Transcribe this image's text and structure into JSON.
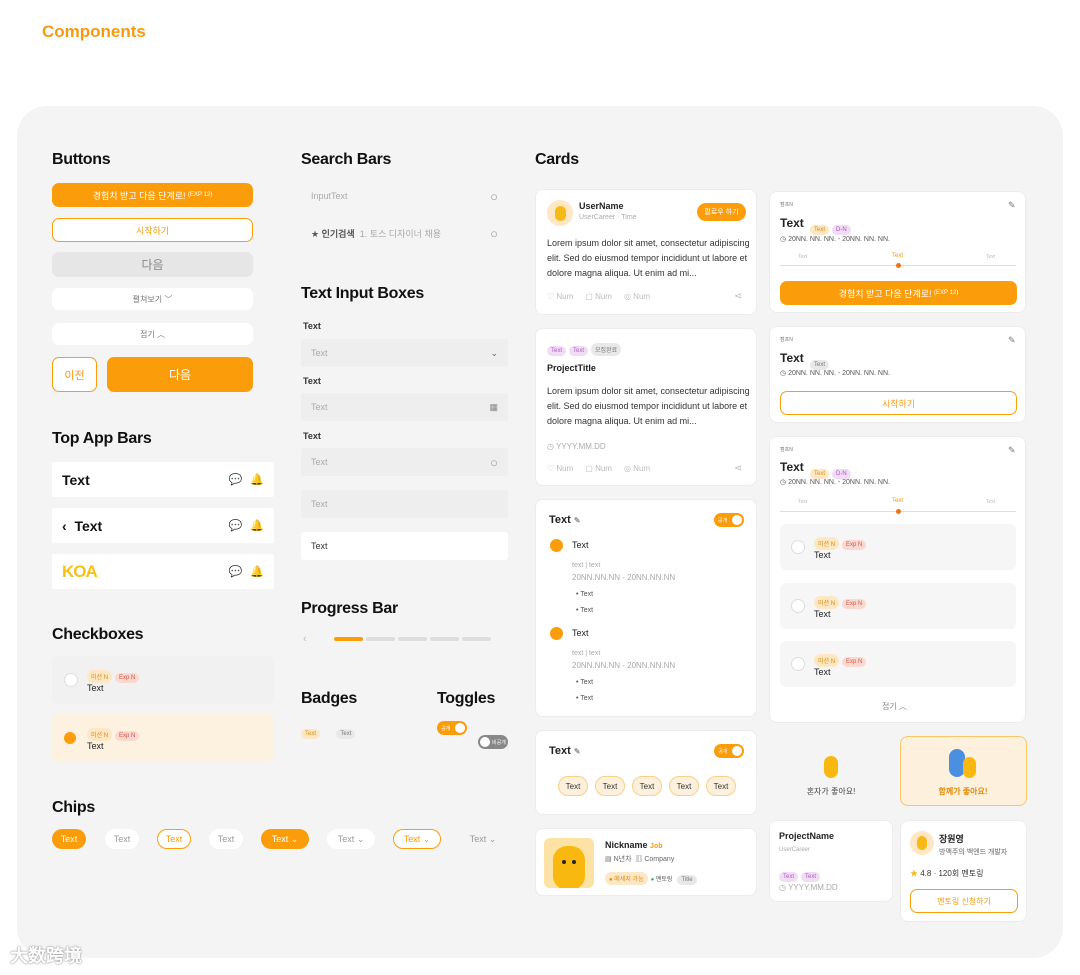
{
  "page_title": "Components",
  "sections": {
    "buttons": "Buttons",
    "search": "Search Bars",
    "text_input": "Text Input Boxes",
    "top_app": "Top App Bars",
    "checkboxes": "Checkboxes",
    "progress": "Progress Bar",
    "badges": "Badges",
    "toggles": "Toggles",
    "chips": "Chips",
    "cards": "Cards"
  },
  "buttons": {
    "primary": "경험치 받고 다음 단계로!",
    "primary_exp": "(EXP 12)",
    "start": "시작하기",
    "next_disabled": "다음",
    "more": "펼쳐보기",
    "fold": "접기",
    "prev": "이전",
    "next": "다음"
  },
  "search": {
    "placeholder1": "InputText",
    "popular": "인기검색",
    "popular_item": "1. 토스 디자이너 채용"
  },
  "inputs": {
    "label": "Text",
    "placeholder": "Text",
    "filled": "Text"
  },
  "appbars": {
    "title": "Text",
    "logo": "KOA"
  },
  "checkbox": {
    "tag1": "미션 N",
    "tag2": "Exp N",
    "text": "Text"
  },
  "badges": {
    "b1": "Text",
    "b2": "Text"
  },
  "toggles": {
    "on": "공개",
    "off": "비공개"
  },
  "chips": [
    "Text",
    "Text",
    "Text",
    "Text",
    "Text",
    "Text",
    "Text",
    "Text"
  ],
  "card_user": {
    "name": "UserName",
    "meta": "UserCareer · Time",
    "action": "팔로우 하기",
    "lorem": "Lorem ipsum dolor sit amet, consectetur adipiscing elit. Sed do eiusmod tempor incididunt ut labore et dolore magna aliqua. Ut enim ad mi...",
    "num": "Num"
  },
  "card_project": {
    "tags": [
      "Text",
      "Text",
      "모집완료"
    ],
    "title": "ProjectTitle",
    "date": "YYYY.MM.DD"
  },
  "card_mission": {
    "title": "Text",
    "item": "Text",
    "sub": "text | text",
    "range": "20NN.NN.NN - 20NN.NN.NN",
    "bullet": "Text"
  },
  "card_chips": {
    "title": "Text",
    "chips": [
      "Text",
      "Text",
      "Text",
      "Text",
      "Text"
    ]
  },
  "card_profile": {
    "name": "Nickname",
    "job": "Job",
    "line1": "N년차",
    "line2": "Company",
    "badge": "메세지 가능",
    "status": "멘토링",
    "title": "Title"
  },
  "right_cards": {
    "small": "캠프N",
    "title": "Text",
    "tag": "Text",
    "dn": "D-N",
    "range": "20NN. NN. NN. - 20NN. NN. NN.",
    "step": "Text",
    "fold": "접기"
  },
  "choice": {
    "alone": "혼자가 좋아요!",
    "together": "함께가 좋아요!"
  },
  "project_card": {
    "name": "ProjectName",
    "career": "UserCareer",
    "date": "YYYY.MM.DD"
  },
  "mentor": {
    "name": "장원영",
    "desc": "방맥주의 백엔드 개발자",
    "rating": "4.8",
    "count": "120회 멘토링",
    "btn": "멘토링 신청하기"
  },
  "watermark": "大数跨境",
  "colors": {
    "accent": "#fb9d0b",
    "board": "#f4f4f4"
  }
}
